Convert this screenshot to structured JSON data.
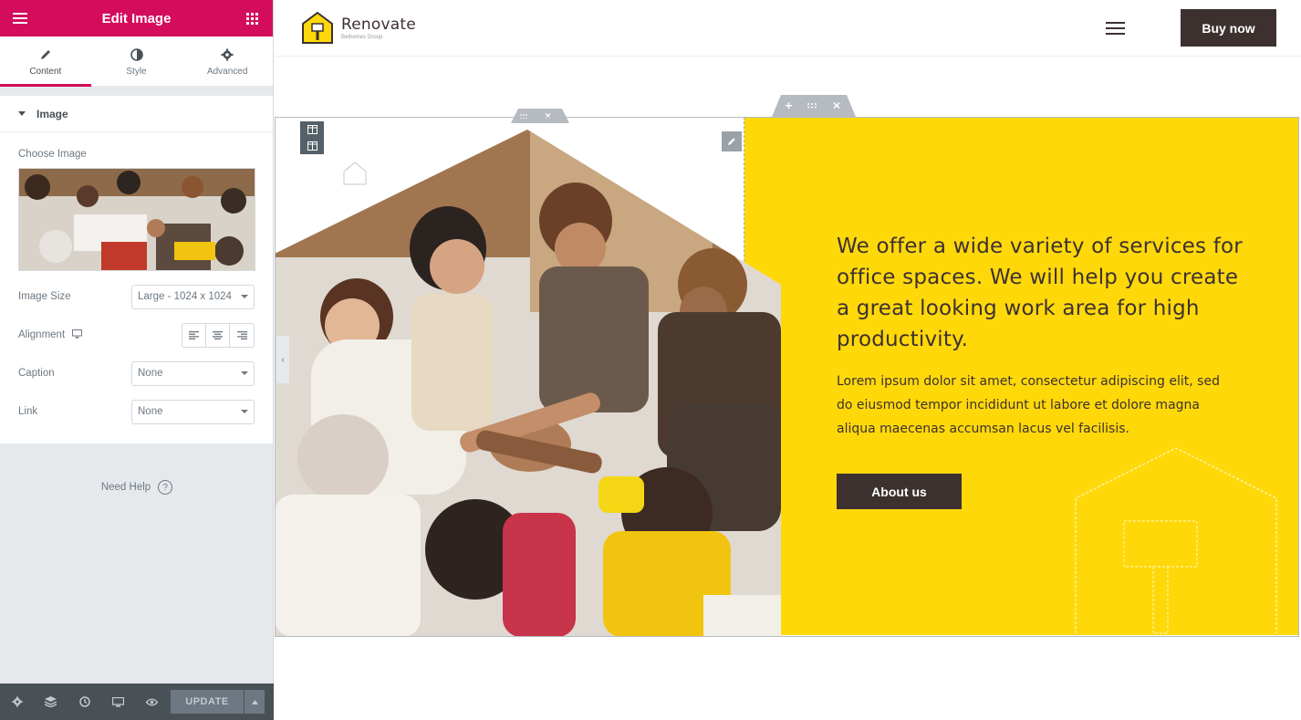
{
  "panel": {
    "title": "Edit Image",
    "tabs": [
      {
        "label": "Content",
        "icon": "pencil-icon",
        "active": true
      },
      {
        "label": "Style",
        "icon": "contrast-icon",
        "active": false
      },
      {
        "label": "Advanced",
        "icon": "gear-icon",
        "active": false
      }
    ],
    "section_title": "Image",
    "choose_image_label": "Choose Image",
    "image_size_label": "Image Size",
    "image_size_value": "Large - 1024 x 1024",
    "alignment_label": "Alignment",
    "caption_label": "Caption",
    "caption_value": "None",
    "link_label": "Link",
    "link_value": "None",
    "need_help": "Need Help",
    "help_icon_glyph": "?",
    "update_label": "UPDATE",
    "accent_color": "#d30c5c"
  },
  "site": {
    "logo_name": "Renovate",
    "logo_tagline": "Bethemes Group",
    "buy_now": "Buy now",
    "headline": "We offer a wide variety of services for office spaces. We will help you create a great looking work area for high productivity.",
    "body": "Lorem ipsum dolor sit amet, consectetur adipiscing elit, sed do eiusmod tempor incididunt ut labore et dolore magna aliqua maecenas accumsan lacus vel facilisis.",
    "about_button": "About us",
    "brand_yellow": "#ffd80a",
    "brand_dark": "#3d3130"
  }
}
